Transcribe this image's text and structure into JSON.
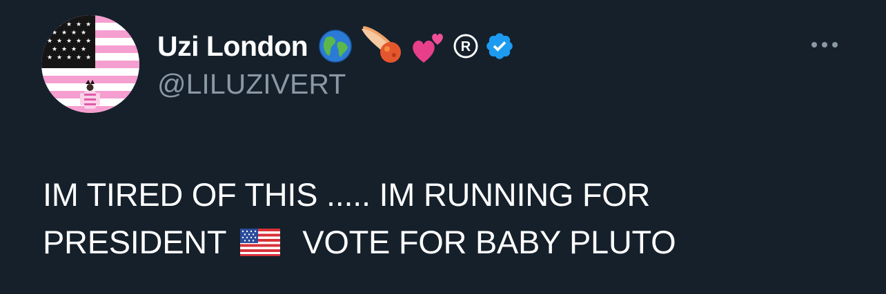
{
  "profile": {
    "display_name": "Uzi London",
    "badges": [
      "globe-icon",
      "comet-icon",
      "two-hearts-icon",
      "registered-icon",
      "verified-icon"
    ],
    "handle": "@LILUZIVERT",
    "verified_color": "#1d9bf0"
  },
  "tweet": {
    "line1": "IM TIRED OF THIS ..... IM RUNNING FOR",
    "line2_a": "PRESIDENT",
    "line2_flag": "us-flag-icon",
    "line2_b": "VOTE FOR BABY PLUTO"
  },
  "colors": {
    "background": "#15202b",
    "text": "#ffffff",
    "secondary_text": "#8b98a5",
    "avatar_pink": "#f7a9d2"
  }
}
